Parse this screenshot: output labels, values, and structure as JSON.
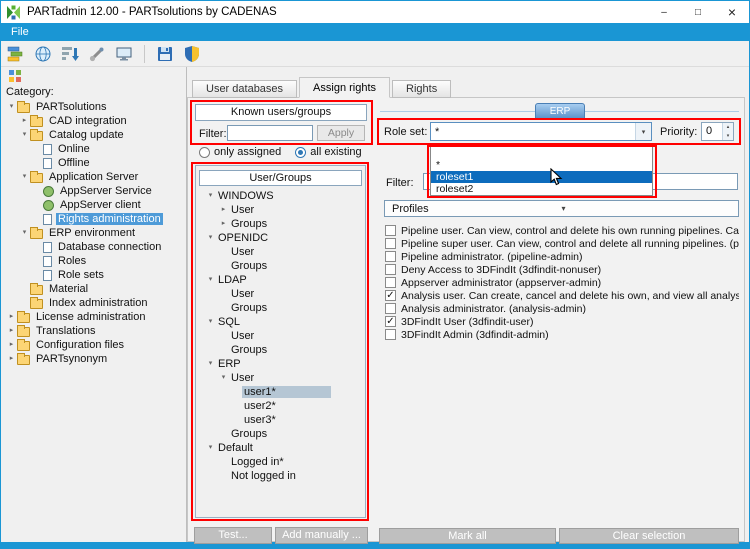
{
  "window": {
    "title": "PARTadmin 12.00 - PARTsolutions by CADENAS",
    "controls": {
      "minimize": "–",
      "maximize": "□",
      "close": "×"
    }
  },
  "menu": {
    "items": [
      {
        "label": "File"
      }
    ]
  },
  "toolbar": {
    "icons": [
      "catalog-icon",
      "globe-icon",
      "sort-icon",
      "tools-icon",
      "monitor-icon",
      "save-icon",
      "shield-icon"
    ]
  },
  "category_panel": {
    "label": "Category:",
    "tree": [
      {
        "label": "PARTsolutions",
        "level": 0,
        "expander": "down",
        "icon": "folder"
      },
      {
        "label": "CAD integration",
        "level": 1,
        "expander": "right",
        "icon": "folder"
      },
      {
        "label": "Catalog update",
        "level": 1,
        "expander": "down",
        "icon": "folder"
      },
      {
        "label": "Online",
        "level": 2,
        "expander": "none",
        "icon": "page"
      },
      {
        "label": "Offline",
        "level": 2,
        "expander": "none",
        "icon": "page"
      },
      {
        "label": "Application Server",
        "level": 1,
        "expander": "down",
        "icon": "folder"
      },
      {
        "label": "AppServer Service",
        "level": 2,
        "expander": "none",
        "icon": "gear"
      },
      {
        "label": "AppServer client",
        "level": 2,
        "expander": "none",
        "icon": "gear"
      },
      {
        "label": "Rights administration",
        "level": 2,
        "expander": "none",
        "icon": "page",
        "selected": true
      },
      {
        "label": "ERP environment",
        "level": 1,
        "expander": "down",
        "icon": "folder"
      },
      {
        "label": "Database connection",
        "level": 2,
        "expander": "none",
        "icon": "page"
      },
      {
        "label": "Roles",
        "level": 2,
        "expander": "none",
        "icon": "page"
      },
      {
        "label": "Role sets",
        "level": 2,
        "expander": "none",
        "icon": "page"
      },
      {
        "label": "Material",
        "level": 1,
        "expander": "none",
        "icon": "folder"
      },
      {
        "label": "Index administration",
        "level": 1,
        "expander": "none",
        "icon": "folder"
      },
      {
        "label": "License administration",
        "level": 0,
        "expander": "right",
        "icon": "folder"
      },
      {
        "label": "Translations",
        "level": 0,
        "expander": "right",
        "icon": "folder"
      },
      {
        "label": "Configuration files",
        "level": 0,
        "expander": "right",
        "icon": "folder"
      },
      {
        "label": "PARTsynonym",
        "level": 0,
        "expander": "right",
        "icon": "folder"
      }
    ]
  },
  "tabs": [
    {
      "label": "User databases",
      "active": false
    },
    {
      "label": "Assign rights",
      "active": true
    },
    {
      "label": "Rights",
      "active": false
    }
  ],
  "known_users": {
    "title": "Known users/groups",
    "filter_label": "Filter:",
    "filter_value": "",
    "apply_label": "Apply",
    "radios": [
      {
        "label": "only assigned",
        "selected": false
      },
      {
        "label": "all existing",
        "selected": true
      }
    ],
    "tree_header": "User/Groups",
    "tree": [
      {
        "label": "WINDOWS",
        "level": 0,
        "expander": "down"
      },
      {
        "label": "User",
        "level": 1,
        "expander": "right"
      },
      {
        "label": "Groups",
        "level": 1,
        "expander": "right"
      },
      {
        "label": "OPENIDC",
        "level": 0,
        "expander": "down"
      },
      {
        "label": "User",
        "level": 1,
        "expander": "none"
      },
      {
        "label": "Groups",
        "level": 1,
        "expander": "none"
      },
      {
        "label": "LDAP",
        "level": 0,
        "expander": "down"
      },
      {
        "label": "User",
        "level": 1,
        "expander": "none"
      },
      {
        "label": "Groups",
        "level": 1,
        "expander": "none"
      },
      {
        "label": "SQL",
        "level": 0,
        "expander": "down"
      },
      {
        "label": "User",
        "level": 1,
        "expander": "none"
      },
      {
        "label": "Groups",
        "level": 1,
        "expander": "none"
      },
      {
        "label": "ERP",
        "level": 0,
        "expander": "down"
      },
      {
        "label": "User",
        "level": 1,
        "expander": "down"
      },
      {
        "label": "user1*",
        "level": 2,
        "expander": "none",
        "selected": true
      },
      {
        "label": "user2*",
        "level": 2,
        "expander": "none"
      },
      {
        "label": "user3*",
        "level": 2,
        "expander": "none"
      },
      {
        "label": "Groups",
        "level": 1,
        "expander": "none"
      },
      {
        "label": "Default",
        "level": 0,
        "expander": "down"
      },
      {
        "label": "Logged in*",
        "level": 1,
        "expander": "none"
      },
      {
        "label": "Not logged in",
        "level": 1,
        "expander": "none"
      }
    ],
    "test_button": "Test...",
    "add_button": "Add manually ..."
  },
  "erp": {
    "title": "ERP",
    "role_set_label": "Role set:",
    "role_set_value": "*",
    "dropdown_options": [
      {
        "label": "",
        "highlighted": false
      },
      {
        "label": "*",
        "highlighted": false
      },
      {
        "label": "roleset1",
        "highlighted": true
      },
      {
        "label": "roleset2",
        "highlighted": false
      }
    ],
    "priority_label": "Priority:",
    "priority_value": "0",
    "filter_label": "Filter:",
    "filter_value": "",
    "profiles_header": "Profiles",
    "profiles": [
      {
        "label": "Pipeline user. Can view, control and delete his own running pipelines. Can v...",
        "checked": false
      },
      {
        "label": "Pipeline super user. Can view, control and delete all running pipelines. (pipe...",
        "checked": false
      },
      {
        "label": "Pipeline administrator. (pipeline-admin)",
        "checked": false
      },
      {
        "label": "Deny Access to 3DFindIt (3dfindit-nonuser)",
        "checked": false
      },
      {
        "label": "Appserver administrator (appserver-admin)",
        "checked": false
      },
      {
        "label": "Analysis user. Can create, cancel and delete his own, and view all analyses (...",
        "checked": true
      },
      {
        "label": "Analysis administrator. (analysis-admin)",
        "checked": false
      },
      {
        "label": "3DFindIt User (3dfindit-user)",
        "checked": true
      },
      {
        "label": "3DFindIt Admin (3dfindit-admin)",
        "checked": false
      }
    ],
    "mark_all_button": "Mark all",
    "clear_selection_button": "Clear selection"
  },
  "colors": {
    "menubar_blue": "#1a96d4",
    "selection_blue": "#0d6cbd",
    "highlight_red": "#ff0000"
  }
}
